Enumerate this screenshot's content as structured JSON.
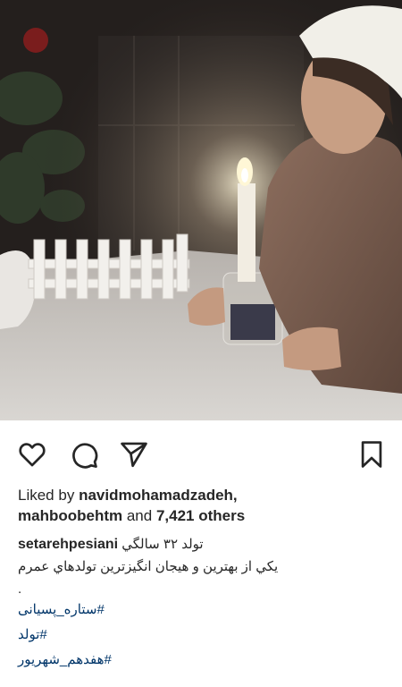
{
  "post": {
    "liked_by_prefix": "Liked by",
    "liker_1": "navidmohamadzadeh,",
    "liker_2": "mahboobehtm",
    "and_text": "and",
    "others_count": "7,421 others",
    "caption_user": "setarehpesiani",
    "caption_line_1": "تولد ۳۲ سالگي",
    "caption_line_2": "يكي از بهترين و هيجان انگيزترين تولدهاي عمرم",
    "caption_dot": ".",
    "hashtags": [
      "#ستاره_پسیانی",
      "#تولد",
      "#هفدهم_شهریور"
    ]
  },
  "icons": {
    "like": "heart-outline",
    "comment": "speech-bubble",
    "share": "paper-plane",
    "save": "bookmark"
  },
  "colors": {
    "text": "#262626",
    "hashtag": "#003569"
  }
}
